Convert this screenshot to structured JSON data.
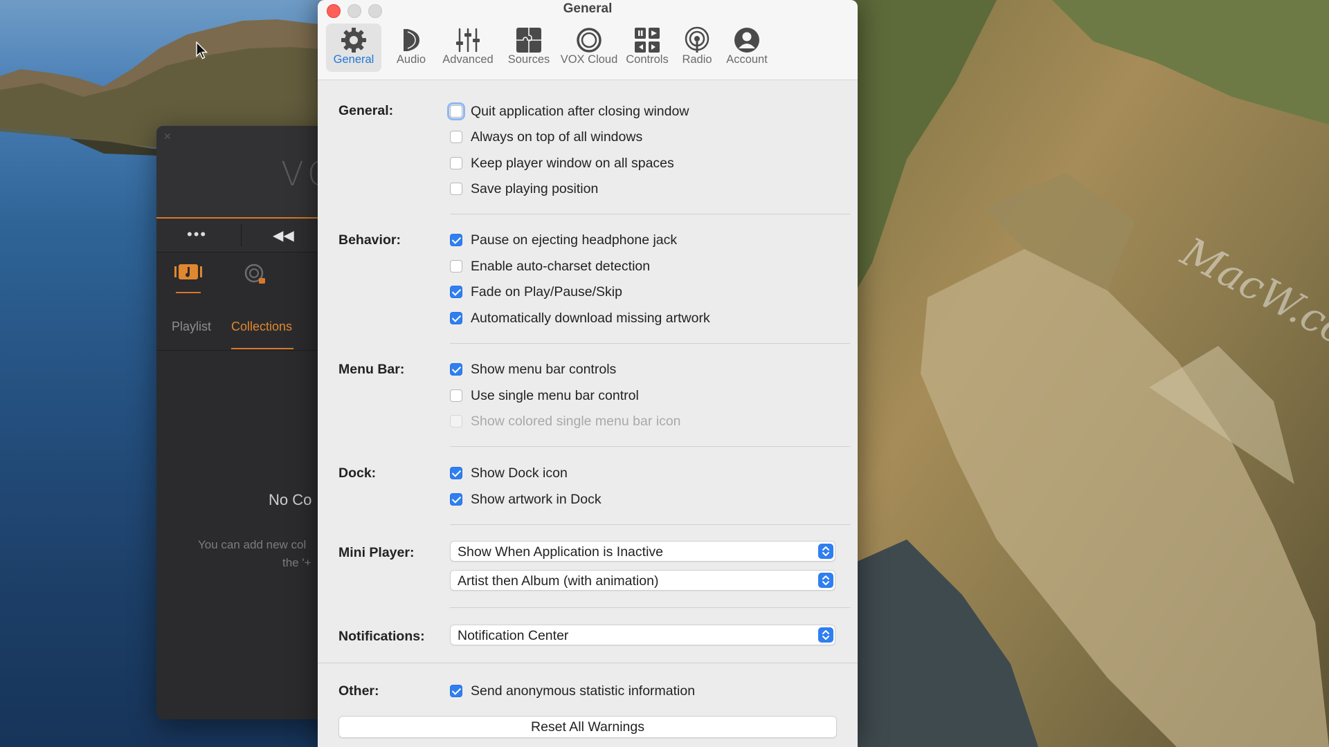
{
  "desktop": {
    "watermark": "MacW.com"
  },
  "vox_window": {
    "logo": "VO",
    "controls": {
      "more": "•••"
    },
    "tabs": {
      "playlist": "Playlist",
      "collections": "Collections"
    },
    "empty_title": "No Co",
    "empty_text_line1": "You can add new col",
    "empty_text_line2": "the '+"
  },
  "prefs": {
    "title": "General",
    "toolbar": [
      {
        "label": "General",
        "icon": "gear-icon",
        "active": true
      },
      {
        "label": "Audio",
        "icon": "speaker-icon",
        "active": false
      },
      {
        "label": "Advanced",
        "icon": "sliders-icon",
        "active": false
      },
      {
        "label": "Sources",
        "icon": "puzzle-icon",
        "active": false
      },
      {
        "label": "VOX Cloud",
        "icon": "cloud-ring-icon",
        "active": false
      },
      {
        "label": "Controls",
        "icon": "media-controls-icon",
        "active": false
      },
      {
        "label": "Radio",
        "icon": "radio-icon",
        "active": false
      },
      {
        "label": "Account",
        "icon": "account-icon",
        "active": false
      }
    ],
    "sections": {
      "general": {
        "label": "General:",
        "options": [
          {
            "label": "Quit application after closing window",
            "checked": false
          },
          {
            "label": "Always on top of all windows",
            "checked": false
          },
          {
            "label": "Keep player window on all spaces",
            "checked": false
          },
          {
            "label": "Save playing position",
            "checked": false
          }
        ]
      },
      "behavior": {
        "label": "Behavior:",
        "options": [
          {
            "label": "Pause on ejecting headphone jack",
            "checked": true
          },
          {
            "label": "Enable auto-charset detection",
            "checked": false
          },
          {
            "label": "Fade on Play/Pause/Skip",
            "checked": true
          },
          {
            "label": "Automatically download missing artwork",
            "checked": true
          }
        ]
      },
      "menubar": {
        "label": "Menu Bar:",
        "options": [
          {
            "label": "Show menu bar controls",
            "checked": true
          },
          {
            "label": "Use single menu bar control",
            "checked": false
          },
          {
            "label": "Show colored single menu bar icon",
            "checked": false,
            "disabled": true
          }
        ]
      },
      "dock": {
        "label": "Dock:",
        "options": [
          {
            "label": "Show Dock icon",
            "checked": true
          },
          {
            "label": "Show artwork in Dock",
            "checked": true
          }
        ]
      },
      "miniplayer": {
        "label": "Mini Player:",
        "select1": "Show When Application is Inactive",
        "select2": "Artist then Album (with animation)"
      },
      "notifications": {
        "label": "Notifications:",
        "select": "Notification Center"
      },
      "other": {
        "label": "Other:",
        "options": [
          {
            "label": "Send anonymous statistic information",
            "checked": true
          }
        ],
        "reset_button": "Reset All Warnings"
      }
    }
  },
  "colors": {
    "accent": "#2f7ff0",
    "vox_orange": "#e0872f",
    "close_red": "#fe5f57"
  }
}
